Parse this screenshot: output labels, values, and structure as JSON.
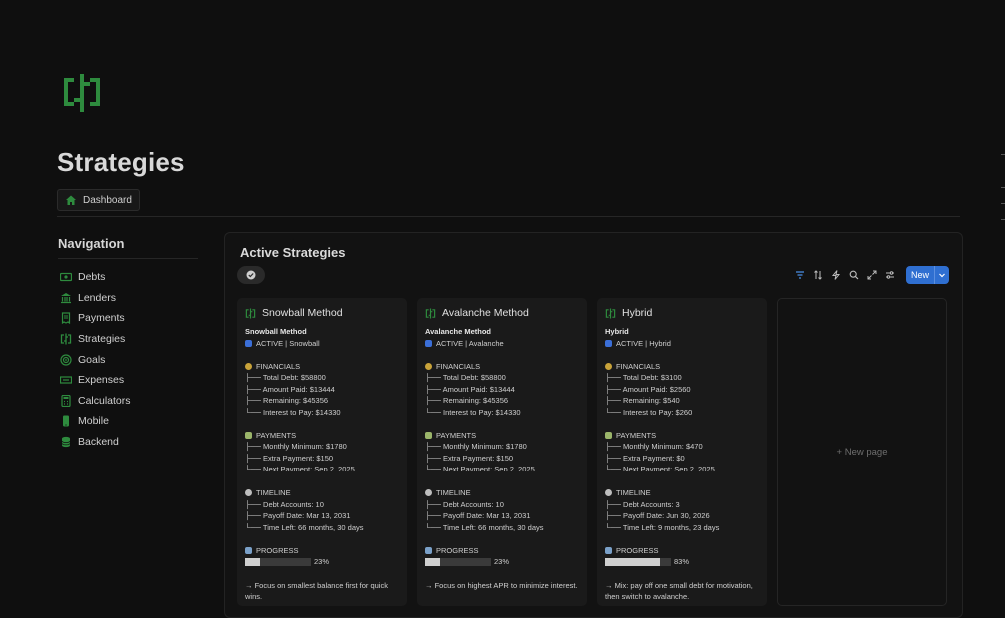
{
  "page": {
    "title": "Strategies",
    "breadcrumb": "Dashboard"
  },
  "nav": {
    "heading": "Navigation",
    "items": [
      {
        "label": "Debts",
        "icon": "money-icon"
      },
      {
        "label": "Lenders",
        "icon": "bank-icon"
      },
      {
        "label": "Payments",
        "icon": "receipt-icon"
      },
      {
        "label": "Strategies",
        "icon": "strategy-icon"
      },
      {
        "label": "Goals",
        "icon": "target-icon"
      },
      {
        "label": "Expenses",
        "icon": "cash-icon"
      },
      {
        "label": "Calculators",
        "icon": "calculator-icon"
      },
      {
        "label": "Mobile",
        "icon": "phone-icon"
      },
      {
        "label": "Backend",
        "icon": "database-icon"
      }
    ]
  },
  "board": {
    "title": "Active Strategies",
    "new_label": "New",
    "new_page_label": "+ New page",
    "toolbar_icons": [
      "filter-icon",
      "sort-icon",
      "bolt-icon",
      "search-icon",
      "expand-icon",
      "settings-icon"
    ]
  },
  "colors": {
    "accent": "#2f6fd1",
    "brand_green": "#2e8b3e"
  },
  "cards": [
    {
      "title": "Snowball Method",
      "name_bold": "Snowball Method",
      "status": "ACTIVE | Snowball",
      "financials_label": "FINANCIALS",
      "total_debt": "├── Total Debt: $58800",
      "amount_paid": "├── Amount Paid: $13444",
      "remaining": "├── Remaining: $45356",
      "interest": "└── Interest to Pay: $14330",
      "payments_label": "PAYMENTS",
      "min": "├── Monthly Minimum: $1780",
      "extra": "├── Extra Payment: $150",
      "next": "└── Next Payment: Sep 2, 2025",
      "timeline_label": "TIMELINE",
      "accounts": "├── Debt Accounts: 10",
      "payoff": "├── Payoff Date: Mar 13, 2031",
      "left": "└── Time Left: 66 months, 30 days",
      "progress_label": "PROGRESS",
      "progress_text": "23%",
      "progress_value": 0.23,
      "note": "→ Focus on smallest balance first for quick wins."
    },
    {
      "title": "Avalanche Method",
      "name_bold": "Avalanche Method",
      "status": "ACTIVE | Avalanche",
      "financials_label": "FINANCIALS",
      "total_debt": "├── Total Debt: $58800",
      "amount_paid": "├── Amount Paid: $13444",
      "remaining": "├── Remaining: $45356",
      "interest": "└── Interest to Pay: $14330",
      "payments_label": "PAYMENTS",
      "min": "├── Monthly Minimum: $1780",
      "extra": "├── Extra Payment: $150",
      "next": "└── Next Payment: Sep 2, 2025",
      "timeline_label": "TIMELINE",
      "accounts": "├── Debt Accounts: 10",
      "payoff": "├── Payoff Date: Mar 13, 2031",
      "left": "└── Time Left: 66 months, 30 days",
      "progress_label": "PROGRESS",
      "progress_text": "23%",
      "progress_value": 0.23,
      "note": "→ Focus on highest APR to minimize interest."
    },
    {
      "title": "Hybrid",
      "name_bold": "Hybrid",
      "status": "ACTIVE | Hybrid",
      "financials_label": "FINANCIALS",
      "total_debt": "├── Total Debt: $3100",
      "amount_paid": "├── Amount Paid: $2560",
      "remaining": "├── Remaining: $540",
      "interest": "└── Interest to Pay: $260",
      "payments_label": "PAYMENTS",
      "min": "├── Monthly Minimum: $470",
      "extra": "├── Extra Payment: $0",
      "next": "└── Next Payment: Sep 2, 2025",
      "timeline_label": "TIMELINE",
      "accounts": "├── Debt Accounts: 3",
      "payoff": "├── Payoff Date: Jun 30, 2026",
      "left": "└── Time Left: 9 months, 23 days",
      "progress_label": "PROGRESS",
      "progress_text": "83%",
      "progress_value": 0.83,
      "note": "→ Mix: pay off one small debt for motivation, then switch to avalanche."
    }
  ]
}
